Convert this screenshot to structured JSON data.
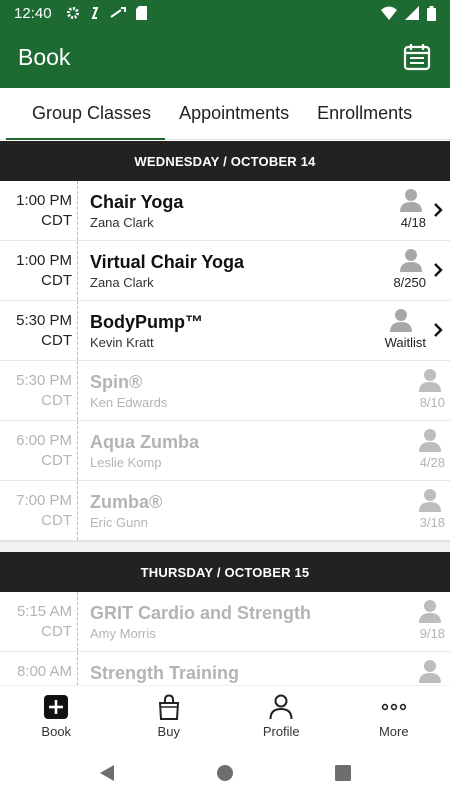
{
  "status_bar": {
    "time": "12:40"
  },
  "app_bar": {
    "title": "Book"
  },
  "tabs": [
    {
      "label": "Group Classes",
      "active": true
    },
    {
      "label": "Appointments",
      "active": false
    },
    {
      "label": "Enrollments",
      "active": false
    }
  ],
  "days": [
    {
      "header": "WEDNESDAY / OCTOBER 14",
      "classes": [
        {
          "time": "1:00 PM",
          "tz": "CDT",
          "name": "Chair Yoga",
          "instructor": "Zana Clark",
          "capacity": "4/18",
          "enabled": true
        },
        {
          "time": "1:00 PM",
          "tz": "CDT",
          "name": "Virtual Chair Yoga",
          "instructor": "Zana Clark",
          "capacity": "8/250",
          "enabled": true
        },
        {
          "time": "5:30 PM",
          "tz": "CDT",
          "name": "BodyPump™",
          "instructor": "Kevin Kratt",
          "capacity": "Waitlist",
          "enabled": true
        },
        {
          "time": "5:30 PM",
          "tz": "CDT",
          "name": "Spin®",
          "instructor": "Ken Edwards",
          "capacity": "8/10",
          "enabled": false
        },
        {
          "time": "6:00 PM",
          "tz": "CDT",
          "name": "Aqua Zumba",
          "instructor": "Leslie Komp",
          "capacity": "4/28",
          "enabled": false
        },
        {
          "time": "7:00 PM",
          "tz": "CDT",
          "name": "Zumba®",
          "instructor": "Eric Gunn",
          "capacity": "3/18",
          "enabled": false
        }
      ]
    },
    {
      "header": "THURSDAY / OCTOBER 15",
      "classes": [
        {
          "time": "5:15 AM",
          "tz": "CDT",
          "name": "GRIT Cardio and Strength",
          "instructor": "Amy Morris",
          "capacity": "9/18",
          "enabled": false
        },
        {
          "time": "8:00 AM",
          "tz": "",
          "name": "Strength Training",
          "instructor": "",
          "capacity": "",
          "enabled": false
        }
      ]
    }
  ],
  "bottom_nav": [
    {
      "label": "Book",
      "icon": "plus-square-icon"
    },
    {
      "label": "Buy",
      "icon": "shopping-bag-icon"
    },
    {
      "label": "Profile",
      "icon": "person-icon"
    },
    {
      "label": "More",
      "icon": "more-dots-icon"
    }
  ],
  "colors": {
    "brand": "#1d6b33",
    "day_header": "#222222",
    "disabled_text": "#b4b4b4"
  }
}
